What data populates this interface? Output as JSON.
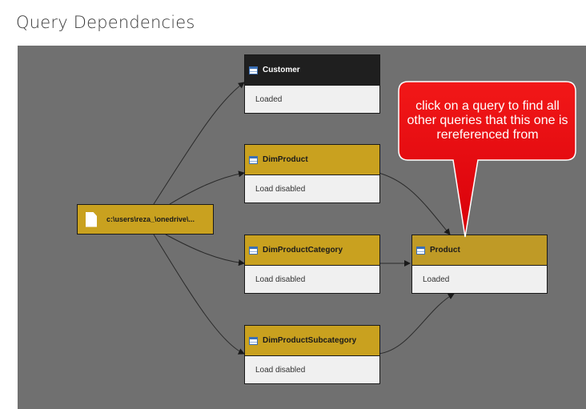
{
  "page": {
    "title": "Query Dependencies"
  },
  "source": {
    "label": "c:\\users\\reza_\\onedrive\\..."
  },
  "queries": [
    {
      "name": "Customer",
      "status": "Loaded"
    },
    {
      "name": "DimProduct",
      "status": "Load disabled"
    },
    {
      "name": "DimProductCategory",
      "status": "Load disabled"
    },
    {
      "name": "DimProductSubcategory",
      "status": "Load disabled"
    },
    {
      "name": "Product",
      "status": "Loaded"
    }
  ],
  "callout": {
    "text": "click on a query to find all other queries that this one is rereferenced from"
  },
  "icons": {
    "query": "table-icon",
    "source": "file-icon"
  },
  "colors": {
    "canvas": "#707070",
    "node_header": "#c9a11f",
    "selected_header": "#1f1f1f",
    "callout": "#e8000c"
  }
}
